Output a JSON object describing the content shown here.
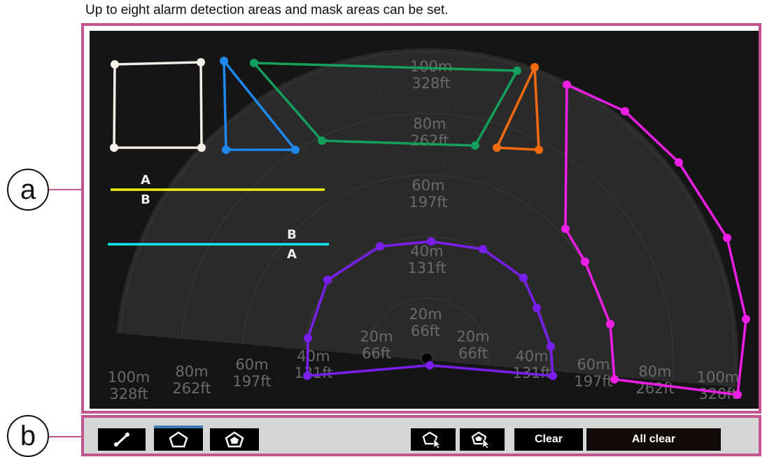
{
  "caption": "Up to eight alarm detection areas and mask areas can be set.",
  "callouts": {
    "a": "a",
    "b": "b"
  },
  "radar": {
    "ring_labels": [
      {
        "m": "20m",
        "ft": "66ft"
      },
      {
        "m": "40m",
        "ft": "131ft"
      },
      {
        "m": "60m",
        "ft": "197ft"
      },
      {
        "m": "80m",
        "ft": "262ft"
      },
      {
        "m": "100m",
        "ft": "328ft"
      }
    ],
    "line_a_labels": {
      "top": "A",
      "bottom": "B"
    },
    "line_b_labels": {
      "top": "B",
      "bottom": "A"
    },
    "colors": {
      "white_area": "#f2efe6",
      "blue_area": "#1e88ef",
      "green_area": "#14a05a",
      "orange_area": "#f36b10",
      "magenta_area": "#ee1ee6",
      "purple_area": "#7a1ef0",
      "yellow_line": "#f2ef14",
      "cyan_line": "#10e6ee",
      "frame": "#c2548f",
      "radar_bg": "#151515",
      "radar_fan": "#2a2a2a"
    }
  },
  "toolbar": {
    "line_tool_icon": "line-tool-icon",
    "polygon_tool_icon": "polygon-tool-icon",
    "mask_tool_icon": "mask-polygon-tool-icon",
    "select_area_icon": "select-area-icon",
    "select_mask_icon": "select-mask-icon",
    "clear_label": "Clear",
    "all_clear_label": "All clear"
  }
}
